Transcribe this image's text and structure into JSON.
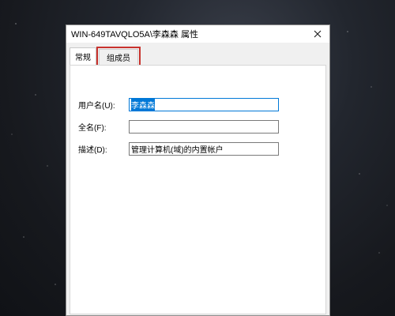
{
  "window": {
    "title": "WIN-649TAVQLO5A\\李森森 属性",
    "close_icon": "close-icon"
  },
  "tabs": [
    {
      "label": "常规",
      "active": true
    },
    {
      "label": "组成员",
      "active": false,
      "highlighted": true
    }
  ],
  "form": {
    "username": {
      "label": "用户名(U):",
      "value": "李森森"
    },
    "fullname": {
      "label": "全名(F):",
      "value": ""
    },
    "description": {
      "label": "描述(D):",
      "value": "管理计算机(域)的内置帐户"
    }
  },
  "colors": {
    "highlight_box": "#c8322d",
    "selection": "#0078d7"
  }
}
